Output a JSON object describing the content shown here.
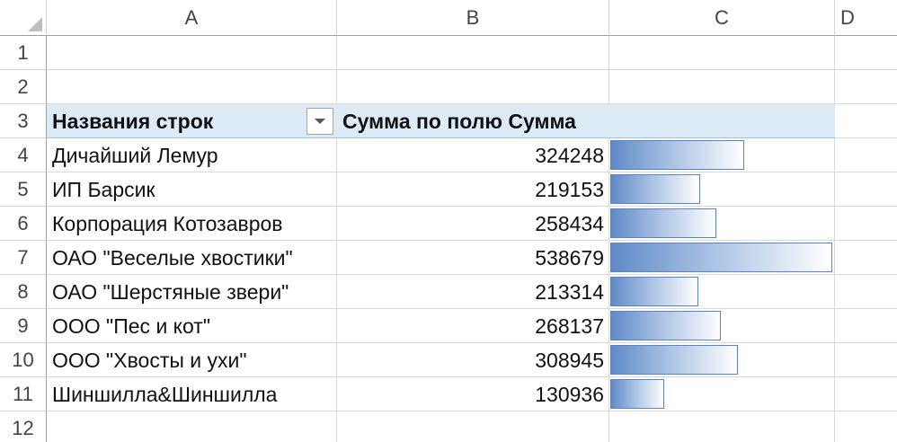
{
  "columns": [
    "A",
    "B",
    "C",
    "D"
  ],
  "rows": [
    "1",
    "2",
    "3",
    "4",
    "5",
    "6",
    "7",
    "8",
    "9",
    "10",
    "11",
    "12"
  ],
  "pivot": {
    "header_rows": "Названия строк",
    "header_values": "Сумма по полю Сумма",
    "filter_icon": "dropdown-arrow-icon",
    "items": [
      {
        "name": "Дичайший Лемур",
        "value": "324248",
        "amount": 324248
      },
      {
        "name": "ИП Барсик",
        "value": "219153",
        "amount": 219153
      },
      {
        "name": "Корпорация Котозавров",
        "value": "258434",
        "amount": 258434
      },
      {
        "name": "ОАО \"Веселые хвостики\"",
        "value": "538679",
        "amount": 538679
      },
      {
        "name": "ОАО \"Шерстяные звери\"",
        "value": "213314",
        "amount": 213314
      },
      {
        "name": "ООО \"Пес и кот\"",
        "value": "268137",
        "amount": 268137
      },
      {
        "name": "ООО \"Хвосты и ухи\"",
        "value": "308945",
        "amount": 308945
      },
      {
        "name": "Шиншилла&Шиншилла",
        "value": "130936",
        "amount": 130936
      }
    ]
  },
  "colors": {
    "header_band": "#ddebf7",
    "databar": "#5b82c2"
  }
}
